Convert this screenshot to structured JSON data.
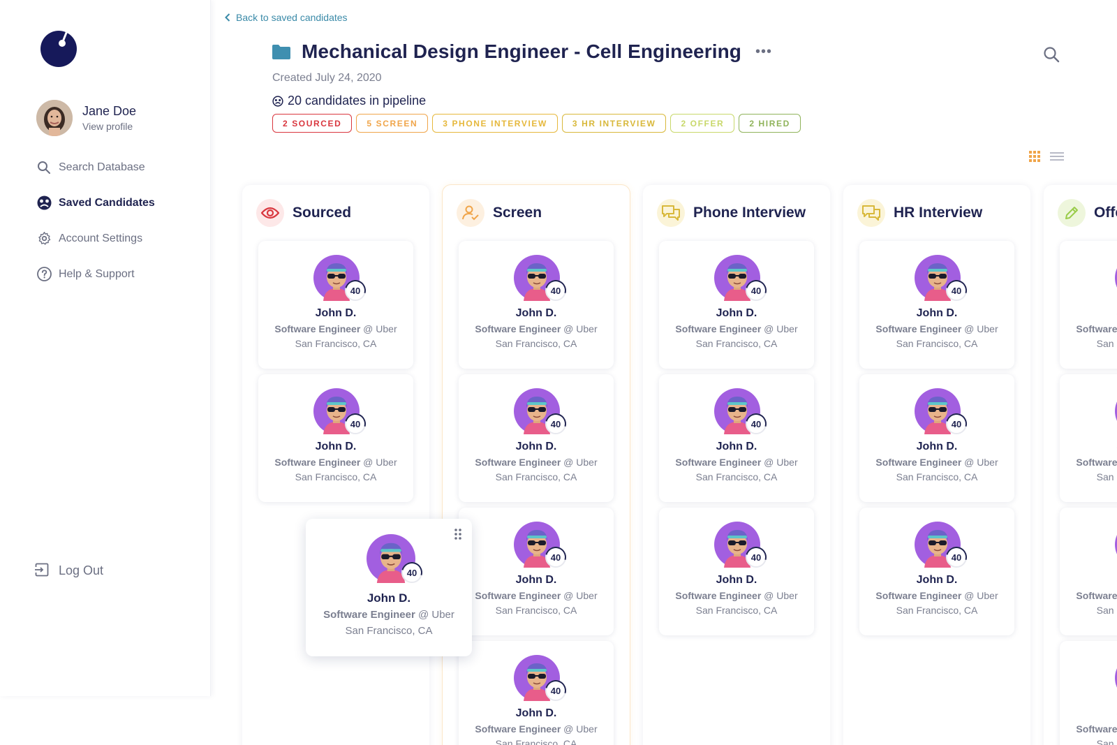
{
  "sidebar": {
    "user": {
      "name": "Jane Doe",
      "profile_link": "View profile"
    },
    "nav": [
      {
        "label": "Search Database",
        "icon": "search-icon",
        "active": false
      },
      {
        "label": "Saved Candidates",
        "icon": "saved-candidates-icon",
        "active": true
      },
      {
        "label": "Account Settings",
        "icon": "gear-icon",
        "active": false
      },
      {
        "label": "Help & Support",
        "icon": "help-icon",
        "active": false
      }
    ],
    "logout": "Log Out"
  },
  "header": {
    "back": "Back to saved candidates",
    "title": "Mechanical Design Engineer - Cell Engineering",
    "more": "•••",
    "created": "Created July 24, 2020",
    "pipeline": "20 candidates in pipeline",
    "stages": [
      {
        "label": "2 SOURCED",
        "color": "#d9363e"
      },
      {
        "label": "5 SCREEN",
        "color": "#f0a54a"
      },
      {
        "label": "3 PHONE INTERVIEW",
        "color": "#e6b83c"
      },
      {
        "label": "3 HR INTERVIEW",
        "color": "#d8b83a"
      },
      {
        "label": "2 OFFER",
        "color": "#c8d86a"
      },
      {
        "label": "2 HIRED",
        "color": "#8fb35a"
      }
    ]
  },
  "columns": [
    {
      "title": "Sourced",
      "icon": "eye-icon",
      "color": "#d9363e",
      "bg": "#fde8e8"
    },
    {
      "title": "Screen",
      "icon": "person-check-icon",
      "color": "#f0a54a",
      "bg": "#fdf0e0"
    },
    {
      "title": "Phone Interview",
      "icon": "chat-icon",
      "color": "#d8b83a",
      "bg": "#fbf4d8"
    },
    {
      "title": "HR Interview",
      "icon": "chat-icon",
      "color": "#d8b83a",
      "bg": "#fbf4d8"
    },
    {
      "title": "Offer",
      "icon": "pencil-icon",
      "color": "#9acc4a",
      "bg": "#eef6dc"
    }
  ],
  "candidate": {
    "name": "John D.",
    "role": "Software Engineer",
    "company": "@ Uber",
    "location": "San Francisco, CA",
    "score": "40"
  }
}
